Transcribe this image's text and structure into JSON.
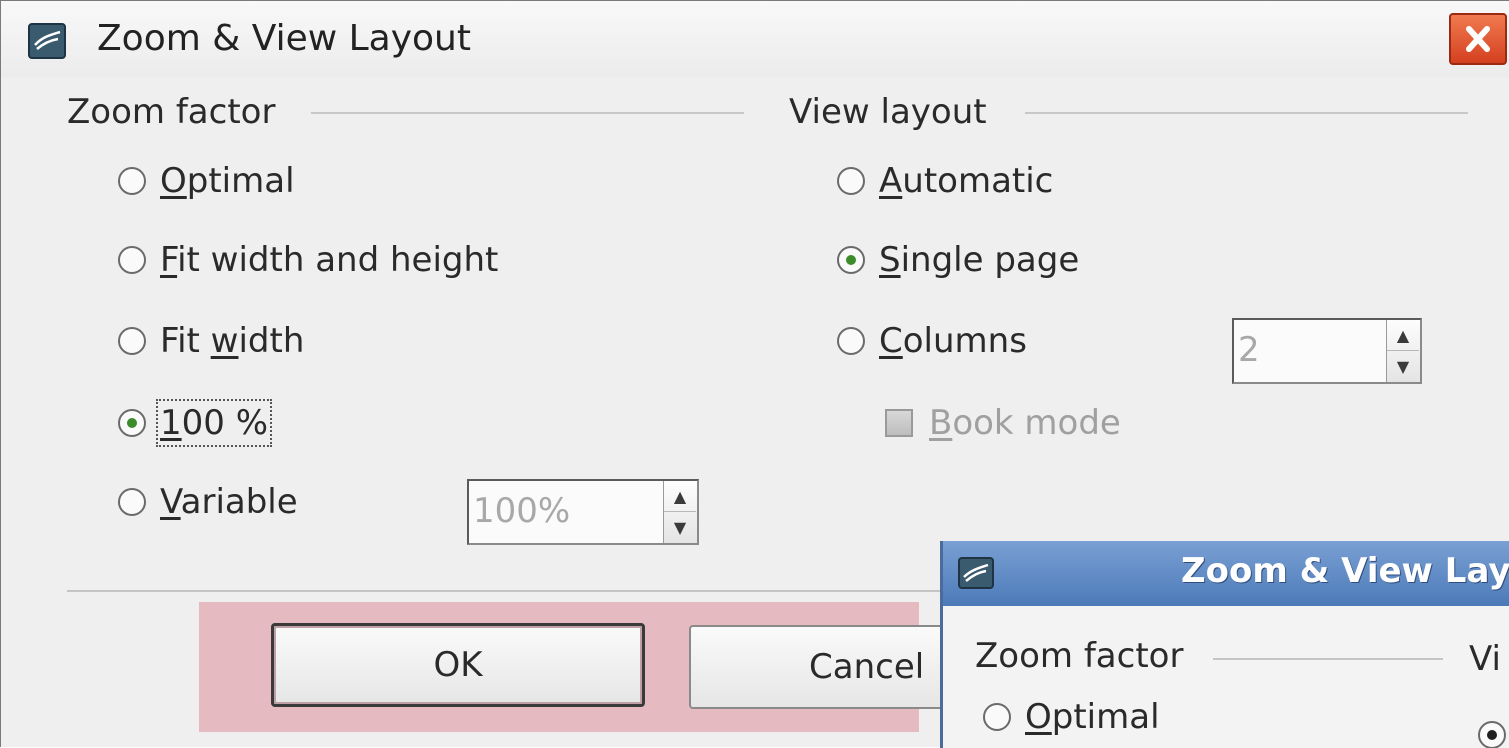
{
  "dialog": {
    "title": "Zoom & View Layout",
    "close_label": "✕"
  },
  "zoom_factor": {
    "label": "Zoom factor",
    "options": [
      {
        "pre": "",
        "u": "O",
        "post": "ptimal",
        "checked": false
      },
      {
        "pre": "",
        "u": "F",
        "post": "it width and height",
        "checked": false
      },
      {
        "pre": "Fit ",
        "u": "w",
        "post": "idth",
        "checked": false
      },
      {
        "pre": "",
        "u": "1",
        "post": "00 %",
        "checked": true
      },
      {
        "pre": "",
        "u": "V",
        "post": "ariable",
        "checked": false
      }
    ],
    "variable_value": "100%"
  },
  "view_layout": {
    "label": "View layout",
    "options": [
      {
        "pre": "",
        "u": "A",
        "post": "utomatic",
        "checked": false
      },
      {
        "pre": "",
        "u": "S",
        "post": "ingle page",
        "checked": true
      },
      {
        "pre": "",
        "u": "C",
        "post": "olumns",
        "checked": false
      }
    ],
    "columns_value": "2",
    "book_mode": {
      "u": "B",
      "post": "ook mode",
      "checked": false
    }
  },
  "buttons": {
    "ok": "OK",
    "cancel": "Cancel"
  },
  "overlay": {
    "title": "Zoom & View Layout",
    "zoom_label": "Zoom factor",
    "optimal": {
      "u": "O",
      "post": "ptimal"
    },
    "view_label_partial": "Vi"
  },
  "colors": {
    "radio_checked": "#3c8c2c",
    "highlight": "#e1a9b1",
    "overlay_titlebar": "#4c7ab8",
    "close_button": "#d44020"
  }
}
